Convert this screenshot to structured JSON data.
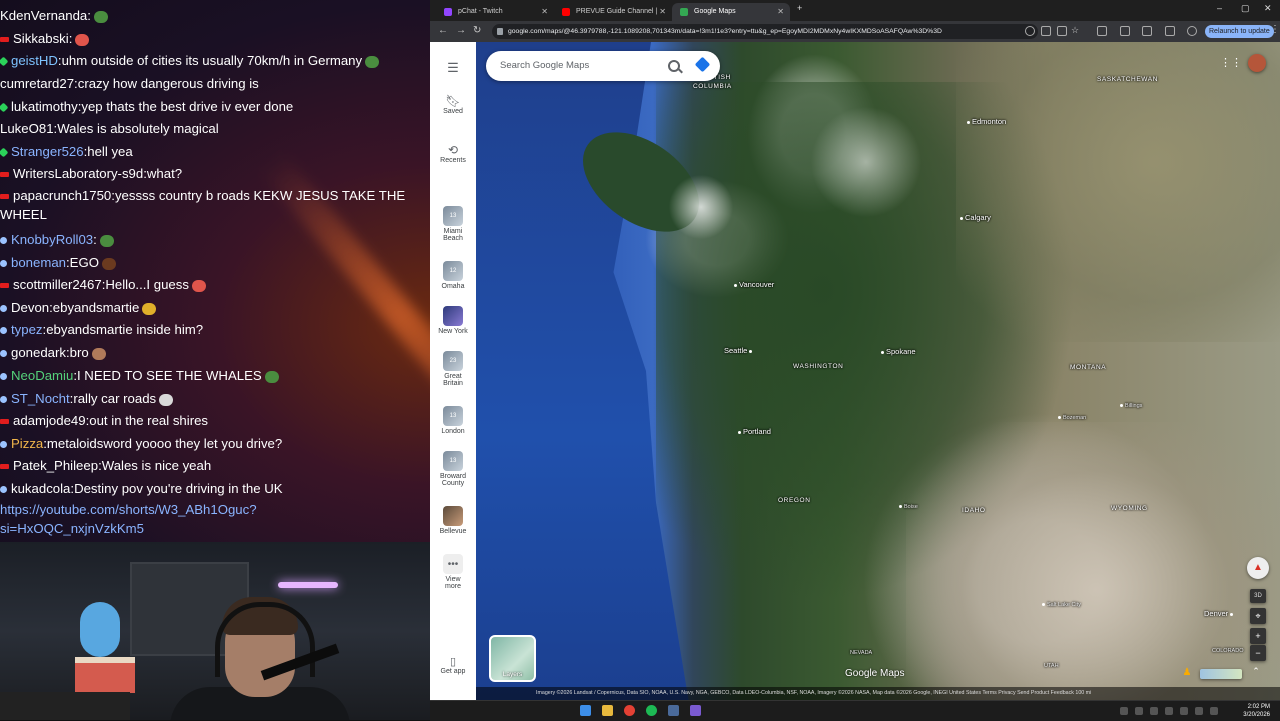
{
  "chat": {
    "messages": [
      {
        "user": "KdenVernanda",
        "text": "",
        "user_color": "#ffffff",
        "badge": "none",
        "emote": "#4a8d3f"
      },
      {
        "user": "Sikkabski",
        "text": "",
        "user_color": "#ffffff",
        "badge": "red",
        "emote": "#e0554b"
      },
      {
        "user": "geistHD",
        "text": "uhm outside of cities its usually 70km/h in Germany",
        "user_color": "#7ec3ff",
        "badge": "green",
        "emote": "#4a8d3f"
      },
      {
        "user": "cumretard27",
        "text": "crazy how dangerous driving is",
        "user_color": "#ffffff",
        "badge": "none",
        "emote": ""
      },
      {
        "user": "lukatimothy",
        "text": "yep thats the best drive iv ever done",
        "user_color": "#ffffff",
        "badge": "green",
        "emote": ""
      },
      {
        "user": "LukeO81",
        "text": "Wales is absolutely magical",
        "user_color": "#ffffff",
        "badge": "none",
        "emote": ""
      },
      {
        "user": "Stranger526",
        "text": "hell yea",
        "user_color": "#8ab4ff",
        "badge": "green",
        "emote": ""
      },
      {
        "user": "WritersLaboratory-s9d",
        "text": "what?",
        "user_color": "#ffffff",
        "badge": "red",
        "emote": ""
      },
      {
        "user": "papacrunch1750",
        "text": "yessss country b roads KEKW JESUS TAKE THE WHEEL",
        "user_color": "#ffffff",
        "badge": "red",
        "emote": ""
      },
      {
        "user": "KnobbyRoll03",
        "text": "",
        "user_color": "#8ab4ff",
        "badge": "blue",
        "emote": "#4a8d3f"
      },
      {
        "user": "boneman",
        "text": "EGO",
        "user_color": "#8ab4ff",
        "badge": "blue",
        "emote": "#6b3a1f"
      },
      {
        "user": "scottmiller2467",
        "text": "Hello...I guess",
        "user_color": "#ffffff",
        "badge": "red",
        "emote": "#e0554b"
      },
      {
        "user": "Devon",
        "text": "ebyandsmartie",
        "user_color": "#ffffff",
        "badge": "blue",
        "emote": "#e0b02a"
      },
      {
        "user": "typez",
        "text": "ebyandsmartie inside him?",
        "user_color": "#8ab4ff",
        "badge": "blue",
        "emote": ""
      },
      {
        "user": "gonedark",
        "text": "bro",
        "user_color": "#ffffff",
        "badge": "blue",
        "emote": "#b07a5a"
      },
      {
        "user": "NeoDamiu",
        "text": "I NEED TO SEE THE WHALES",
        "user_color": "#54d17a",
        "badge": "blue",
        "emote": "#4a8d3f"
      },
      {
        "user": "ST_Nocht",
        "text": "rally car roads",
        "user_color": "#8ab4ff",
        "badge": "blue",
        "emote": "#d9d9d9"
      },
      {
        "user": "adamjode49",
        "text": "out in the real shires",
        "user_color": "#ffffff",
        "badge": "red",
        "emote": ""
      },
      {
        "user": "Pizza",
        "text": "metaloidsword yoooo they let you drive?",
        "user_color": "#f0b54a",
        "badge": "blue",
        "emote": ""
      },
      {
        "user": "Patek_Phileep",
        "text": "Wales is nice yeah",
        "user_color": "#ffffff",
        "badge": "red",
        "emote": ""
      },
      {
        "user": "kukadcola",
        "text": "Destiny pov you're driving in the UK",
        "user_color": "#ffffff",
        "badge": "blue",
        "emote": ""
      }
    ],
    "link_line1": "https://youtube.com/shorts/W3_ABh1Oguc?",
    "link_line2": "si=HxOQC_nxjnVzkKm5"
  },
  "browser": {
    "tabs": [
      {
        "label": "pChat - Twitch",
        "favicon_color": "#9146ff"
      },
      {
        "label": "PREVUE Guide Channel | Nove",
        "favicon_color": "#ff0000"
      },
      {
        "label": "Google Maps",
        "favicon_color": "#34a853"
      }
    ],
    "new_tab": "+",
    "url": "google.com/maps/@46.3979788,-121.1089208,701343m/data=!3m1!1e3?entry=ttu&g_ep=EgoyMDI2MDMxNy4wIKXMDSoASAFQAw%3D%3D",
    "relaunch_label": "Relaunch to update"
  },
  "maps": {
    "search_placeholder": "Search Google Maps",
    "rail": {
      "saved": "Saved",
      "recents": "Recents",
      "places": [
        {
          "label1": "Miami",
          "label2": "Beach",
          "num": "13"
        },
        {
          "label1": "Omaha",
          "label2": "",
          "num": "12"
        },
        {
          "label1": "New York",
          "label2": "",
          "num": ""
        },
        {
          "label1": "Great",
          "label2": "Britain",
          "num": "23"
        },
        {
          "label1": "London",
          "label2": "",
          "num": "13"
        },
        {
          "label1": "Broward",
          "label2": "County",
          "num": "13"
        },
        {
          "label1": "Bellevue",
          "label2": "",
          "num": ""
        }
      ],
      "view_more1": "View",
      "view_more2": "more",
      "get_app": "Get app"
    },
    "labels": {
      "bc1": "BRITISH",
      "bc2": "COLUMBIA",
      "saskatchewan": "SASKATCHEWAN",
      "edmonton": "Edmonton",
      "calgary": "Calgary",
      "vancouver": "Vancouver",
      "seattle": "Seattle",
      "spokane": "Spokane",
      "washington": "WASHINGTON",
      "montana": "MONTANA",
      "portland": "Portland",
      "bozeman": "Bozeman",
      "billings": "Billings",
      "oregon": "OREGON",
      "boise": "Boise",
      "idaho": "IDAHO",
      "wyoming": "WYOMING",
      "salt_lake": "Salt Lake City",
      "denver": "Denver",
      "colorado": "COLORADO",
      "nevada": "NEVADA",
      "utah": "UTAH"
    },
    "layers_label": "Layers",
    "logo_text": "Google Maps",
    "tilt_label": "3D",
    "attribution": "Imagery ©2026 Landsat / Copernicus, Data SIO, NOAA, U.S. Navy, NGA, GEBCO, Data LDEO-Columbia, NSF, NOAA, Imagery ©2026 NASA, Map data ©2026 Google, INEGI   United States   Terms   Privacy   Send Product Feedback   100 mi"
  },
  "taskbar": {
    "time": "2:02 PM",
    "date": "3/20/2026"
  }
}
